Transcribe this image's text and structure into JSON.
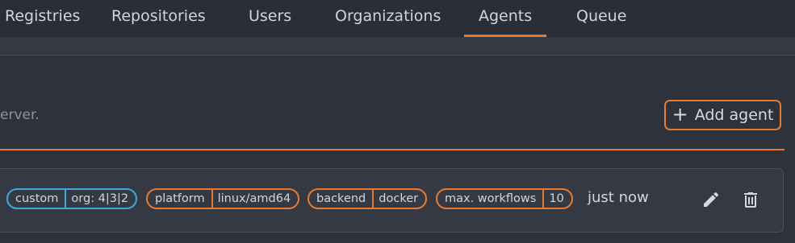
{
  "nav": {
    "items": [
      {
        "label": "Registries"
      },
      {
        "label": "Repositories"
      },
      {
        "label": "Users"
      },
      {
        "label": "Organizations"
      },
      {
        "label": "Agents"
      },
      {
        "label": "Queue"
      }
    ],
    "active": "Agents"
  },
  "section": {
    "description": "erver.",
    "add_button_label": "Add agent"
  },
  "agent": {
    "badges": [
      {
        "key": "custom",
        "value": "org: 4|3|2",
        "color": "#3fa9d6"
      },
      {
        "key": "platform",
        "value": "linux/amd64",
        "color": "#e8792d"
      },
      {
        "key": "backend",
        "value": "docker",
        "color": "#e8792d"
      },
      {
        "key": "max. workflows",
        "value": "10",
        "color": "#e8792d"
      }
    ],
    "last_contact": "just now",
    "icons": [
      "edit-icon",
      "trash-icon"
    ]
  },
  "colors": {
    "accent": "#e8792d",
    "info": "#3fa9d6",
    "background": "#2e323b"
  }
}
